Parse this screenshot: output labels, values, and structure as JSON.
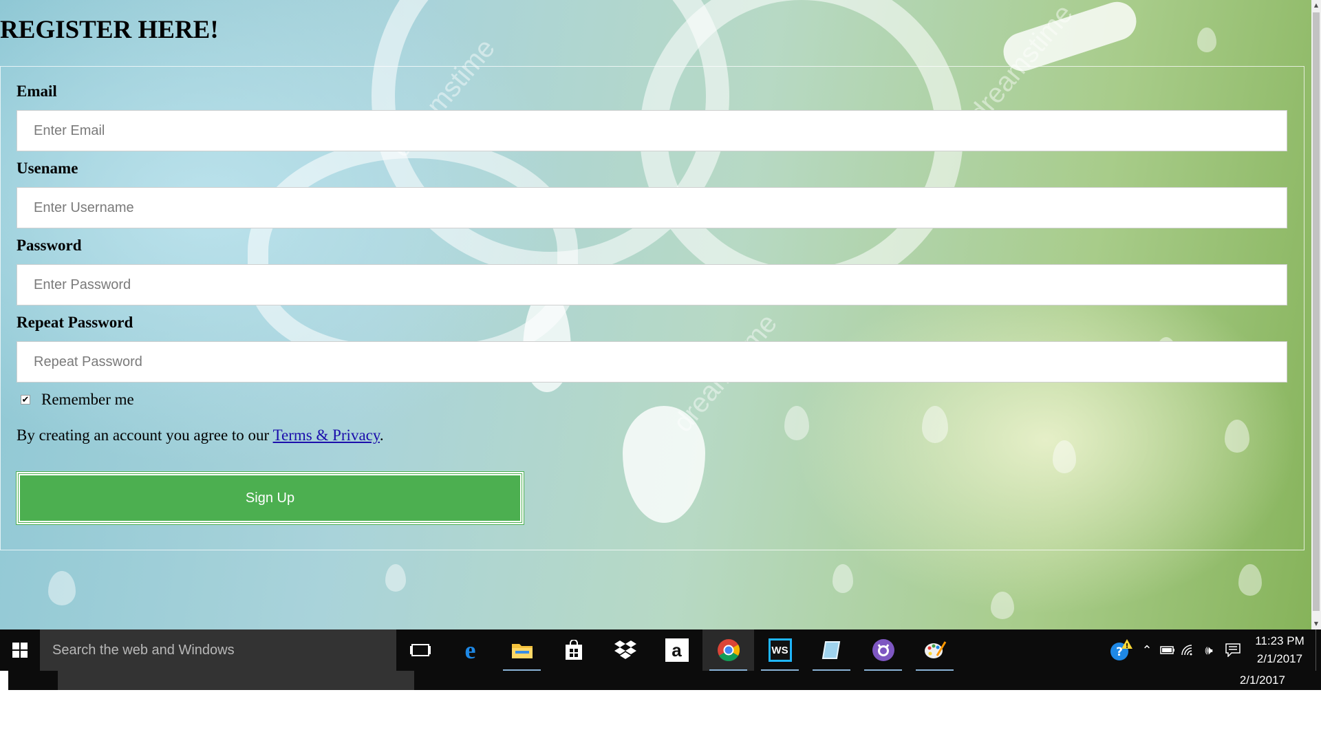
{
  "page": {
    "title": "REGISTER HERE!",
    "fields": [
      {
        "label": "Email",
        "placeholder": "Enter Email"
      },
      {
        "label": "Usename",
        "placeholder": "Enter Username"
      },
      {
        "label": "Password",
        "placeholder": "Enter Password"
      },
      {
        "label": "Repeat Password",
        "placeholder": "Repeat Password"
      }
    ],
    "remember": {
      "label": "Remember me",
      "checked": true,
      "check_glyph": "✔"
    },
    "agreement": {
      "prefix": "By creating an account you agree to our ",
      "link": "Terms & Privacy",
      "suffix": "."
    },
    "signup_label": "Sign Up",
    "watermark": "dreamstime",
    "colors": {
      "signup_bg": "#4caf50",
      "link": "#1a0dab"
    }
  },
  "taskbar": {
    "search_placeholder": "Search the web and Windows",
    "apps": [
      {
        "name": "task-view-icon"
      },
      {
        "name": "edge-icon"
      },
      {
        "name": "file-explorer-icon"
      },
      {
        "name": "store-icon"
      },
      {
        "name": "dropbox-icon"
      },
      {
        "name": "amazon-icon",
        "text": "a"
      },
      {
        "name": "chrome-icon",
        "active": true
      },
      {
        "name": "webstorm-icon",
        "text": "WS"
      },
      {
        "name": "notepad-icon"
      },
      {
        "name": "github-icon"
      },
      {
        "name": "paint-icon"
      }
    ],
    "tray": {
      "time": "11:23 PM",
      "date": "2/1/2017"
    }
  }
}
